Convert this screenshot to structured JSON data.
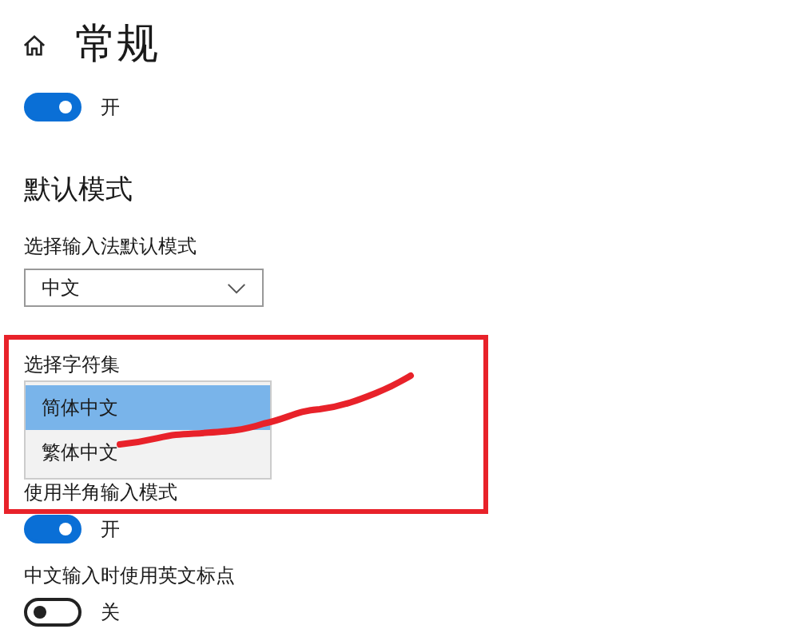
{
  "header": {
    "title": "常规"
  },
  "items": [
    {
      "kind": "toggle",
      "on": true,
      "state_label": "开"
    },
    {
      "kind": "heading",
      "text": "默认模式"
    },
    {
      "kind": "dropdown",
      "label": "选择输入法默认模式",
      "value": "中文"
    },
    {
      "kind": "listbox",
      "label": "选择字符集",
      "options": [
        {
          "text": "简体中文",
          "selected": true
        },
        {
          "text": "繁体中文",
          "selected": false
        }
      ]
    },
    {
      "kind": "toggle",
      "label": "使用半角输入模式",
      "on": true,
      "state_label": "开"
    },
    {
      "kind": "toggle",
      "label": "中文输入时使用英文标点",
      "on": false,
      "state_label": "关"
    }
  ],
  "annotations": {
    "red_frame": true,
    "scribble": true
  }
}
